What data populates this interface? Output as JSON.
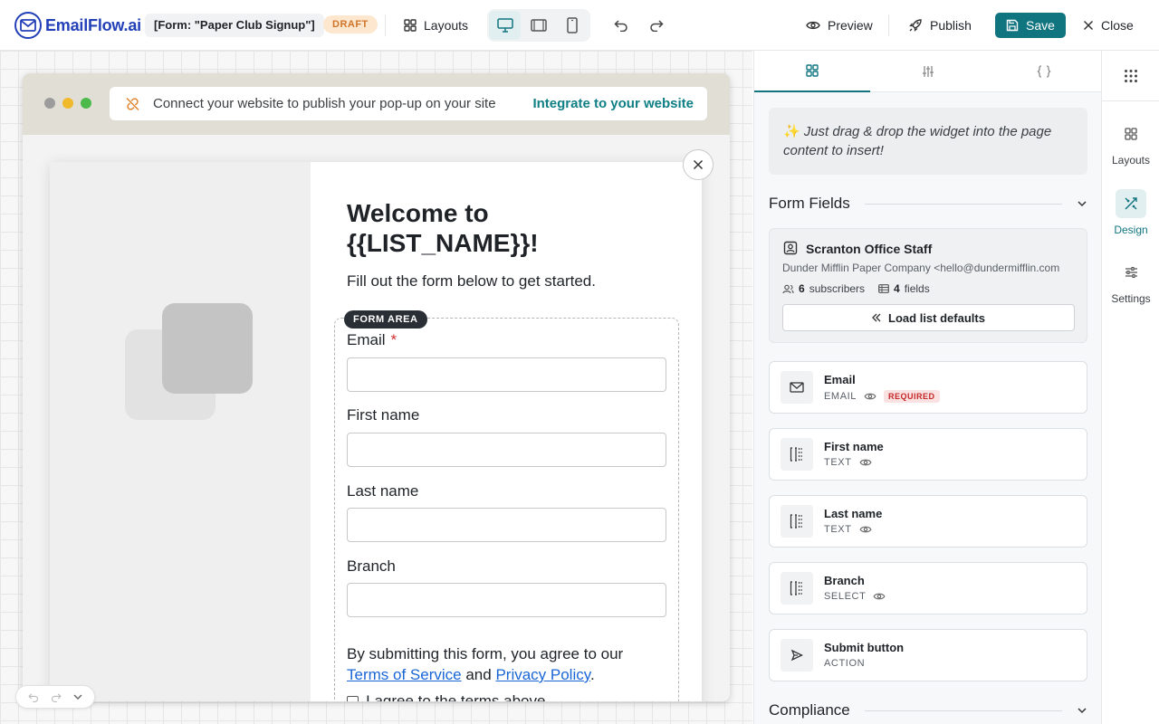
{
  "colors": {
    "brand": "#2340b8",
    "accent": "#117580",
    "draft": "#d0742a",
    "required": "#c62828",
    "link": "#1a66d6"
  },
  "topbar": {
    "logo_text": "EmailFlow.ai",
    "form_name": "[Form: \"Paper Club Signup\"]",
    "status": "DRAFT",
    "layouts_label": "Layouts",
    "preview_label": "Preview",
    "publish_label": "Publish",
    "save_label": "Save",
    "close_label": "Close",
    "devices": [
      "desktop-icon",
      "tablet-icon",
      "mobile-icon"
    ],
    "active_device": "desktop"
  },
  "browser": {
    "notice": "Connect your website to publish your pop-up on your site",
    "integrate_link": "Integrate to your website"
  },
  "popup": {
    "title": "Welcome to {{LIST_NAME}}!",
    "subtitle": "Fill out the form below to get started.",
    "form_area_badge": "FORM AREA",
    "fields": [
      {
        "label": "Email",
        "required": "*"
      },
      {
        "label": "First name"
      },
      {
        "label": "Last name"
      },
      {
        "label": "Branch"
      }
    ],
    "consent_prefix": "By submitting this form, you agree to our",
    "terms_link": "Terms of Service",
    "consent_and": "and",
    "privacy_link": "Privacy Policy",
    "consent_suffix": ".",
    "agree_label": "I agree to the terms above"
  },
  "panel": {
    "tabs": [
      "layout-grid-icon",
      "sliders-icon",
      "code-braces-icon"
    ],
    "active_tab": 0,
    "tip": "Just drag & drop the widget into the page content to insert!",
    "form_fields_title": "Form Fields",
    "list": {
      "name": "Scranton Office Staff",
      "company": "Dunder Mifflin Paper Company <hello@dundermifflin.com",
      "subscribers_count": "6",
      "subscribers_label": "subscribers",
      "fields_count": "4",
      "fields_label": "fields",
      "load_defaults": "Load list defaults"
    },
    "field_cards": [
      {
        "name": "Email",
        "type": "EMAIL",
        "badge": "REQUIRED"
      },
      {
        "name": "First name",
        "type": "TEXT"
      },
      {
        "name": "Last name",
        "type": "TEXT"
      },
      {
        "name": "Branch",
        "type": "SELECT"
      },
      {
        "name": "Submit button",
        "type": "ACTION"
      }
    ],
    "compliance_title": "Compliance"
  },
  "rail": {
    "items": [
      {
        "label": "Layouts"
      },
      {
        "label": "Design"
      },
      {
        "label": "Settings"
      }
    ],
    "active": "Design"
  }
}
